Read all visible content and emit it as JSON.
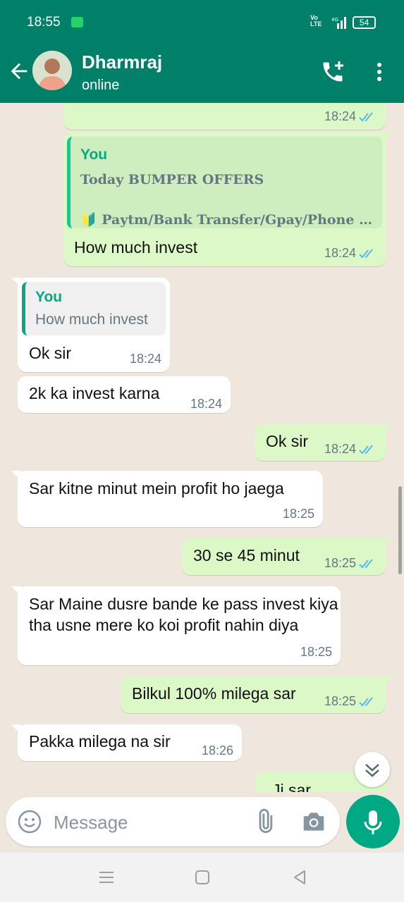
{
  "status_bar": {
    "time": "18:55",
    "network": "Vo LTE",
    "signal": "4G",
    "battery": "54"
  },
  "header": {
    "contact_name": "Dharmraj",
    "status": "online"
  },
  "messages": [
    {
      "direction": "out",
      "time": "18:24",
      "read": true
    },
    {
      "direction": "out",
      "quote": {
        "author": "You",
        "line1": "Today BUMPER OFFERS",
        "line2": "🔰 Paytm/Bank Transfer/Gpay/Phone P..."
      },
      "text": "How much invest",
      "time": "18:24",
      "read": true
    },
    {
      "direction": "in",
      "quote": {
        "author": "You",
        "line1": "How much invest"
      },
      "text": "Ok sir",
      "time": "18:24"
    },
    {
      "direction": "in",
      "text": "2k ka invest karna",
      "time": "18:24"
    },
    {
      "direction": "out",
      "text": "Ok sir",
      "time": "18:24",
      "read": true
    },
    {
      "direction": "in",
      "text": "Sar kitne minut mein profit ho jaega",
      "time": "18:25"
    },
    {
      "direction": "out",
      "text": "30 se 45 minut",
      "time": "18:25",
      "read": true
    },
    {
      "direction": "in",
      "text": "Sar Maine dusre bande ke pass invest kiya tha usne mere ko koi profit nahin diya",
      "time": "18:25"
    },
    {
      "direction": "out",
      "text": "Bilkul 100% milega sar",
      "time": "18:25",
      "read": true
    },
    {
      "direction": "in",
      "text": "Pakka milega na sir",
      "time": "18:26"
    },
    {
      "direction": "out",
      "text": "Ji sar"
    }
  ],
  "composer": {
    "placeholder": "Message"
  },
  "colors": {
    "header": "#008069",
    "outgoing_bubble": "#dcf8c6",
    "incoming_bubble": "#ffffff",
    "read_ticks": "#53bdeb",
    "mic_button": "#00a884"
  }
}
